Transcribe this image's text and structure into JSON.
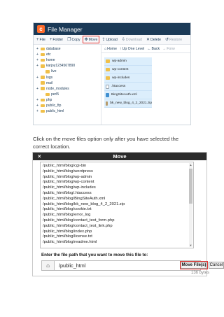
{
  "file_manager": {
    "title": "File Manager",
    "logo_glyph": "c",
    "toolbar": [
      {
        "label": "File",
        "glyph": "+",
        "name": "new-file-button"
      },
      {
        "label": "Folder",
        "glyph": "+",
        "name": "new-folder-button"
      },
      {
        "label": "Copy",
        "glyph": "❐",
        "name": "copy-button"
      },
      {
        "label": "Move",
        "glyph": "✥",
        "name": "move-button",
        "highlight": true
      },
      {
        "label": "Upload",
        "glyph": "⇪",
        "name": "upload-button"
      },
      {
        "label": "Download",
        "glyph": "⇩",
        "name": "download-button",
        "dim": true
      },
      {
        "label": "Delete",
        "glyph": "✕",
        "name": "delete-button"
      },
      {
        "label": "Restore",
        "glyph": "↺",
        "name": "restore-button",
        "dim": true
      }
    ],
    "tree": [
      {
        "label": "database",
        "indent": 0,
        "plus": true
      },
      {
        "label": "etc",
        "indent": 0,
        "plus": true
      },
      {
        "label": "home",
        "indent": 0,
        "plus": true
      },
      {
        "label": "karjoy1234567890",
        "indent": 0,
        "plus": true
      },
      {
        "label": "live",
        "indent": 1,
        "plus": false
      },
      {
        "label": "logs",
        "indent": 0,
        "plus": true
      },
      {
        "label": "mail",
        "indent": 0,
        "plus": false
      },
      {
        "label": "node_modules",
        "indent": 0,
        "plus": true
      },
      {
        "label": "perl5",
        "indent": 1,
        "plus": false
      },
      {
        "label": "php",
        "indent": 0,
        "plus": true
      },
      {
        "label": "public_ftp",
        "indent": 0,
        "plus": true
      },
      {
        "label": "public_html",
        "indent": 0,
        "plus": true
      }
    ],
    "nav": [
      {
        "label": "Home",
        "glyph": "⌂"
      },
      {
        "label": "Up One Level",
        "glyph": "↑"
      },
      {
        "label": "Back",
        "glyph": "←"
      },
      {
        "label": "Forw",
        "glyph": "→",
        "dim": true
      }
    ],
    "files": [
      {
        "name": "wp-admin",
        "type": "folder"
      },
      {
        "name": "wp-content",
        "type": "folder"
      },
      {
        "name": "wp-includes",
        "type": "folder"
      },
      {
        "name": ".htaccess",
        "type": "file"
      },
      {
        "name": "BingSiteAuth.xml",
        "type": "code"
      },
      {
        "name": "bk_new_blog_4_2_2021.zip",
        "type": "zip"
      }
    ],
    "colors": {
      "header": "#1b3a57",
      "highlight": "#e53935",
      "selection": "#dceefc"
    }
  },
  "caption": "Click on the move files option only after you have selected the correct location.",
  "move_dialog": {
    "title": "Move",
    "close_glyph": "×",
    "paths": [
      "/public_html/blog/cgi-bin",
      "/public_html/blog/wordpress",
      "/public_html/blog/wp-admin",
      "/public_html/blog/wp-content",
      "/public_html/blog/wp-includes",
      "/public_html/blog/.htaccess",
      "/public_html/blog/BingSiteAuth.xml",
      "/public_html/blog/bk_new_blog_4_2_2021.zip",
      "/public_html/blog/cookie.txt",
      "/public_html/blog/error_log",
      "/public_html/blog/contact_test_form.php",
      "/public_html/blog/contact_test_link.php",
      "/public_html/blog/index.php",
      "/public_html/blog/license.txt",
      "/public_html/blog/readme.html"
    ],
    "prompt": "Enter the file path that you want to move this file to:",
    "home_glyph": "⌂",
    "path_value": "/public_html",
    "move_label": "Move File(s)",
    "cancel_label": "Cancel",
    "size_text": "136 bytes"
  }
}
